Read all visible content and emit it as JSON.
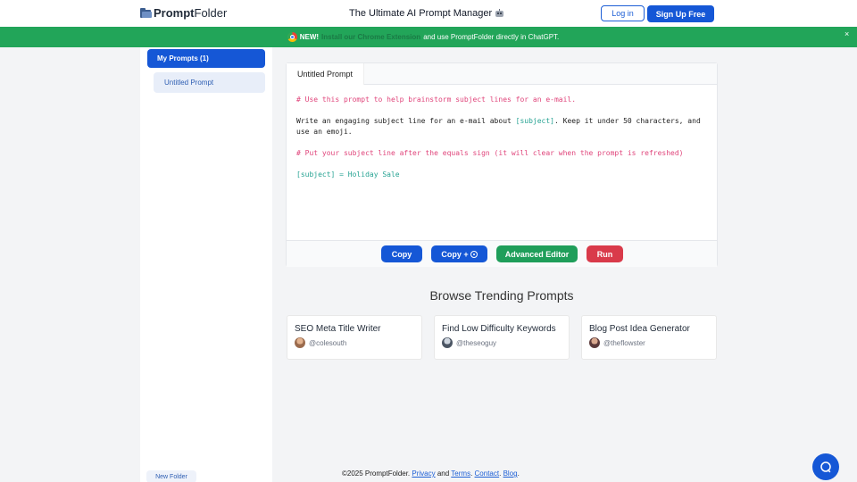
{
  "header": {
    "logo_bold": "Prompt",
    "logo_rest": "Folder",
    "title": "The Ultimate AI Prompt Manager",
    "login_label": "Log in",
    "signup_label": "Sign Up Free"
  },
  "banner": {
    "new_label": "NEW!",
    "link_text": "Install our Chrome Extension",
    "rest_text": "and use PromptFolder directly in ChatGPT.",
    "close_label": "×"
  },
  "sidebar": {
    "folder_label": "My Prompts (1)",
    "prompt_items": [
      {
        "label": "Untitled Prompt"
      }
    ],
    "new_folder_label": "New Folder"
  },
  "editor": {
    "title": "Untitled Prompt",
    "lines": {
      "c1": "# Use this prompt to help brainstorm subject lines for an e-mail.",
      "t1a": "Write an engaging subject line for an e-mail about ",
      "t1var": "[subject]",
      "t1b": ". Keep it under 50 characters, and",
      "t2": "use an emoji.",
      "c2": "# Put your subject line after the equals sign (it will clear when the prompt is refreshed)",
      "v1": "[subject] = Holiday Sale"
    },
    "buttons": {
      "copy": "Copy",
      "copy_plus": "Copy +",
      "advanced": "Advanced Editor",
      "run": "Run"
    }
  },
  "trending": {
    "title": "Browse Trending Prompts",
    "cards": [
      {
        "title": "SEO Meta Title Writer",
        "user": "@colesouth"
      },
      {
        "title": "Find Low Difficulty Keywords",
        "user": "@theseoguy"
      },
      {
        "title": "Blog Post Idea Generator",
        "user": "@theflowster"
      }
    ]
  },
  "footer": {
    "copyright": "©2025 PromptFolder.",
    "privacy": "Privacy",
    "and": "and",
    "terms": "Terms",
    "contact": "Contact",
    "blog": "Blog"
  },
  "colors": {
    "primary": "#1557d6",
    "banner": "#22a559",
    "advanced": "#1f9e5a",
    "run": "#d93a4a",
    "comment": "#e0457b",
    "variable": "#27a393"
  },
  "icons": {
    "logo": "folder-icon",
    "robot": "robot-icon",
    "chrome": "chrome-icon",
    "help": "chat-support-icon"
  }
}
